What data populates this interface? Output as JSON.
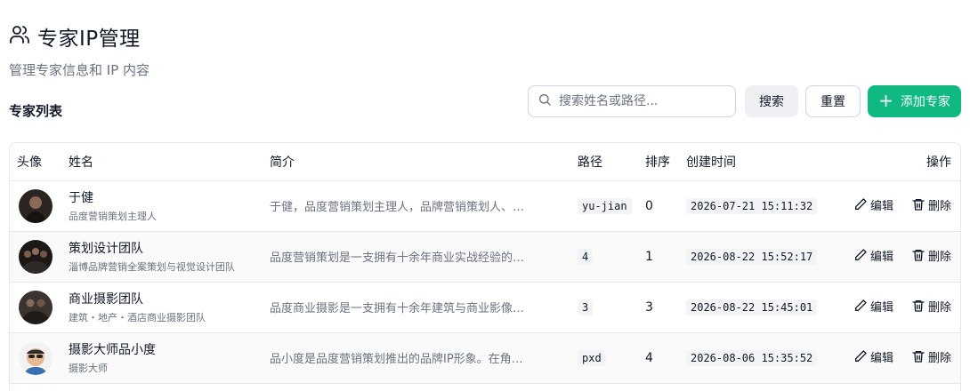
{
  "header": {
    "title": "专家IP管理",
    "subtitle": "管理专家信息和 IP 内容"
  },
  "section_title": "专家列表",
  "toolbar": {
    "search_placeholder": "搜索姓名或路径...",
    "search_label": "搜索",
    "reset_label": "重置",
    "add_label": "添加专家"
  },
  "table": {
    "columns": {
      "avatar": "头像",
      "name": "姓名",
      "intro": "简介",
      "path": "路径",
      "order": "排序",
      "created": "创建时间",
      "actions": "操作"
    },
    "edit_label": "编辑",
    "delete_label": "删除",
    "rows": [
      {
        "name": "于健",
        "title": "品度营销策划主理人",
        "intro": "于健，品度营销策划主理人，品牌营销策划人、…",
        "path": "yu-jian",
        "order": "0",
        "created": "2026-07-21 15:11:32"
      },
      {
        "name": "策划设计团队",
        "title": "淄博品牌营销全案策划与视觉设计团队",
        "intro": "品度营销策划是一支拥有十余年商业实战经验的…",
        "path": "4",
        "order": "1",
        "created": "2026-08-22 15:52:17"
      },
      {
        "name": "商业摄影团队",
        "title": "建筑・地产・酒店商业摄影团队",
        "intro": "品度商业摄影是一支拥有十余年建筑与商业影像…",
        "path": "3",
        "order": "3",
        "created": "2026-08-22 15:45:01"
      },
      {
        "name": "摄影大师品小度",
        "title": "摄影大师",
        "intro": "品小度是品度营销策划推出的品牌IP形象。在角…",
        "path": "pxd",
        "order": "4",
        "created": "2026-08-06 15:35:52"
      }
    ]
  }
}
